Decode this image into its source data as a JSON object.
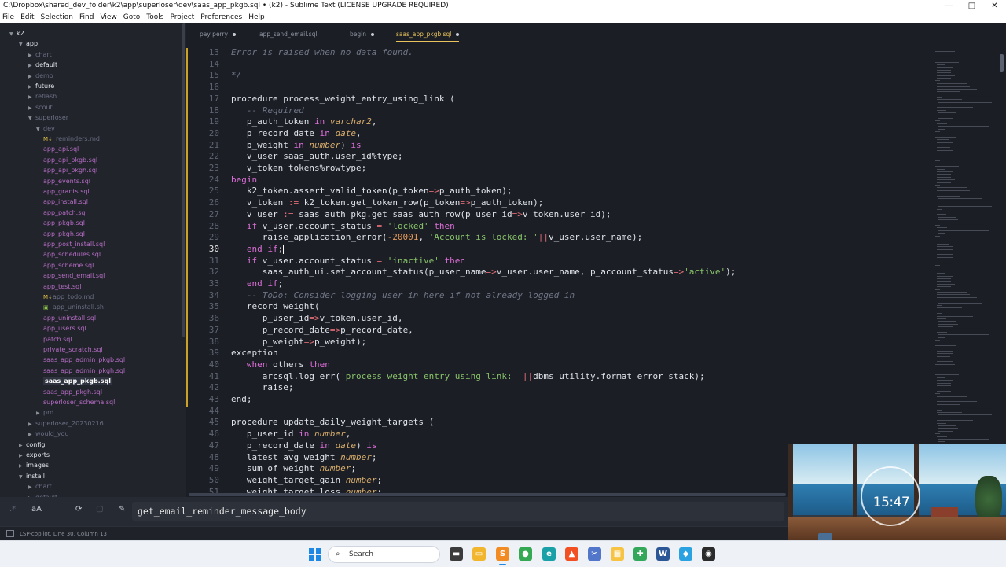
{
  "window": {
    "title": "C:\\Dropbox\\shared_dev_folder\\k2\\app\\superloser\\dev\\saas_app_pkgb.sql • (k2) - Sublime Text (LICENSE UPGRADE REQUIRED)",
    "minimize_glyph": "—",
    "maximize_glyph": "□",
    "close_glyph": "✕"
  },
  "menu": [
    "File",
    "Edit",
    "Selection",
    "Find",
    "View",
    "Goto",
    "Tools",
    "Project",
    "Preferences",
    "Help"
  ],
  "sidebar": {
    "items": [
      {
        "label": "k2",
        "kind": "folder-open",
        "depth": 0,
        "style": "bright"
      },
      {
        "label": "app",
        "kind": "folder-open",
        "depth": 1,
        "style": "bright"
      },
      {
        "label": "chart",
        "kind": "folder",
        "depth": 2,
        "style": "dim"
      },
      {
        "label": "default",
        "kind": "folder",
        "depth": 2,
        "style": "bright"
      },
      {
        "label": "demo",
        "kind": "folder",
        "depth": 2,
        "style": "dim"
      },
      {
        "label": "future",
        "kind": "folder",
        "depth": 2,
        "style": "bright"
      },
      {
        "label": "reflash",
        "kind": "folder",
        "depth": 2,
        "style": "dim"
      },
      {
        "label": "scout",
        "kind": "folder",
        "depth": 2,
        "style": "dim"
      },
      {
        "label": "superloser",
        "kind": "folder-open",
        "depth": 2,
        "style": "dim"
      },
      {
        "label": "dev",
        "kind": "folder-open",
        "depth": 3,
        "style": "dim"
      },
      {
        "label": "_reminders.md",
        "kind": "md",
        "depth": 4,
        "style": "dim"
      },
      {
        "label": "app_api.sql",
        "kind": "sql",
        "depth": 4,
        "style": "sql"
      },
      {
        "label": "app_api_pkgb.sql",
        "kind": "sql",
        "depth": 4,
        "style": "sql"
      },
      {
        "label": "app_api_pkgh.sql",
        "kind": "sql",
        "depth": 4,
        "style": "sql"
      },
      {
        "label": "app_events.sql",
        "kind": "sql",
        "depth": 4,
        "style": "sql"
      },
      {
        "label": "app_grants.sql",
        "kind": "sql",
        "depth": 4,
        "style": "sql"
      },
      {
        "label": "app_install.sql",
        "kind": "sql",
        "depth": 4,
        "style": "sql"
      },
      {
        "label": "app_patch.sql",
        "kind": "sql",
        "depth": 4,
        "style": "sql"
      },
      {
        "label": "app_pkgb.sql",
        "kind": "sql",
        "depth": 4,
        "style": "sql"
      },
      {
        "label": "app_pkgh.sql",
        "kind": "sql",
        "depth": 4,
        "style": "sql"
      },
      {
        "label": "app_post_install.sql",
        "kind": "sql",
        "depth": 4,
        "style": "sql"
      },
      {
        "label": "app_schedules.sql",
        "kind": "sql",
        "depth": 4,
        "style": "sql"
      },
      {
        "label": "app_scheme.sql",
        "kind": "sql",
        "depth": 4,
        "style": "sql"
      },
      {
        "label": "app_send_email.sql",
        "kind": "sql",
        "depth": 4,
        "style": "sql"
      },
      {
        "label": "app_test.sql",
        "kind": "sql",
        "depth": 4,
        "style": "sql"
      },
      {
        "label": "app_todo.md",
        "kind": "md",
        "depth": 4,
        "style": "dim"
      },
      {
        "label": "app_uninstall.sh",
        "kind": "sh",
        "depth": 4,
        "style": "dim"
      },
      {
        "label": "app_uninstall.sql",
        "kind": "sql",
        "depth": 4,
        "style": "sql"
      },
      {
        "label": "app_users.sql",
        "kind": "sql",
        "depth": 4,
        "style": "sql"
      },
      {
        "label": "patch.sql",
        "kind": "sql",
        "depth": 4,
        "style": "sql"
      },
      {
        "label": "private_scratch.sql",
        "kind": "sql",
        "depth": 4,
        "style": "sql"
      },
      {
        "label": "saas_app_admin_pkgb.sql",
        "kind": "sql",
        "depth": 4,
        "style": "sql"
      },
      {
        "label": "saas_app_admin_pkgh.sql",
        "kind": "sql",
        "depth": 4,
        "style": "sql"
      },
      {
        "label": "saas_app_pkgb.sql",
        "kind": "sql",
        "depth": 4,
        "style": "active"
      },
      {
        "label": "saas_app_pkgh.sql",
        "kind": "sql",
        "depth": 4,
        "style": "sql"
      },
      {
        "label": "superloser_schema.sql",
        "kind": "sql",
        "depth": 4,
        "style": "sql"
      },
      {
        "label": "prd",
        "kind": "folder",
        "depth": 3,
        "style": "dim"
      },
      {
        "label": "superloser_20230216",
        "kind": "folder",
        "depth": 2,
        "style": "dim"
      },
      {
        "label": "would_you",
        "kind": "folder",
        "depth": 2,
        "style": "dim"
      },
      {
        "label": "config",
        "kind": "folder",
        "depth": 1,
        "style": "bright"
      },
      {
        "label": "exports",
        "kind": "folder",
        "depth": 1,
        "style": "bright"
      },
      {
        "label": "images",
        "kind": "folder",
        "depth": 1,
        "style": "bright"
      },
      {
        "label": "install",
        "kind": "folder-open",
        "depth": 1,
        "style": "bright"
      },
      {
        "label": "chart",
        "kind": "folder",
        "depth": 2,
        "style": "dim"
      },
      {
        "label": "default",
        "kind": "folder",
        "depth": 2,
        "style": "dim"
      }
    ]
  },
  "tabs": [
    {
      "label": "pay perry",
      "modified": true,
      "active": false
    },
    {
      "label": "app_send_email.sql",
      "modified": false,
      "active": false
    },
    {
      "label": "begin",
      "modified": true,
      "active": false
    },
    {
      "label": "saas_app_pkgb.sql",
      "modified": true,
      "active": true
    }
  ],
  "editor": {
    "current_line": 30,
    "lines": [
      {
        "n": 13,
        "tokens": [
          {
            "t": "Error is raised when no data found.",
            "c": "c"
          }
        ]
      },
      {
        "n": 14,
        "tokens": []
      },
      {
        "n": 15,
        "tokens": [
          {
            "t": "*/",
            "c": "c"
          }
        ]
      },
      {
        "n": 16,
        "tokens": []
      },
      {
        "n": 17,
        "tokens": [
          {
            "t": "procedure process_weight_entry_using_link (",
            "c": ""
          }
        ]
      },
      {
        "n": 18,
        "tokens": [
          {
            "t": "   -- Required",
            "c": "c"
          }
        ]
      },
      {
        "n": 19,
        "tokens": [
          {
            "t": "   p_auth_token ",
            "c": ""
          },
          {
            "t": "in",
            "c": "k"
          },
          {
            "t": " ",
            "c": ""
          },
          {
            "t": "varchar2",
            "c": "t"
          },
          {
            "t": ",",
            "c": ""
          }
        ]
      },
      {
        "n": 20,
        "tokens": [
          {
            "t": "   p_record_date ",
            "c": ""
          },
          {
            "t": "in",
            "c": "k"
          },
          {
            "t": " ",
            "c": ""
          },
          {
            "t": "date",
            "c": "t"
          },
          {
            "t": ",",
            "c": ""
          }
        ]
      },
      {
        "n": 21,
        "tokens": [
          {
            "t": "   p_weight ",
            "c": ""
          },
          {
            "t": "in",
            "c": "k"
          },
          {
            "t": " ",
            "c": ""
          },
          {
            "t": "number",
            "c": "t"
          },
          {
            "t": ") ",
            "c": ""
          },
          {
            "t": "is",
            "c": "k"
          }
        ]
      },
      {
        "n": 22,
        "tokens": [
          {
            "t": "   v_user saas_auth.user_id%type;",
            "c": ""
          }
        ]
      },
      {
        "n": 23,
        "tokens": [
          {
            "t": "   v_token tokens%rowtype;",
            "c": ""
          }
        ]
      },
      {
        "n": 24,
        "tokens": [
          {
            "t": "begin",
            "c": "k"
          }
        ]
      },
      {
        "n": 25,
        "tokens": [
          {
            "t": "   k2_token.assert_valid_token(p_token",
            "c": ""
          },
          {
            "t": "=>",
            "c": "o"
          },
          {
            "t": "p_auth_token);",
            "c": ""
          }
        ]
      },
      {
        "n": 26,
        "tokens": [
          {
            "t": "   v_token ",
            "c": ""
          },
          {
            "t": ":=",
            "c": "o"
          },
          {
            "t": " k2_token.get_token_row(p_token",
            "c": ""
          },
          {
            "t": "=>",
            "c": "o"
          },
          {
            "t": "p_auth_token);",
            "c": ""
          }
        ]
      },
      {
        "n": 27,
        "tokens": [
          {
            "t": "   v_user ",
            "c": ""
          },
          {
            "t": ":=",
            "c": "o"
          },
          {
            "t": " saas_auth_pkg.get_saas_auth_row(p_user_id",
            "c": ""
          },
          {
            "t": "=>",
            "c": "o"
          },
          {
            "t": "v_token.user_id);",
            "c": ""
          }
        ]
      },
      {
        "n": 28,
        "tokens": [
          {
            "t": "   ",
            "c": ""
          },
          {
            "t": "if",
            "c": "k"
          },
          {
            "t": " v_user.account_status ",
            "c": ""
          },
          {
            "t": "=",
            "c": "o"
          },
          {
            "t": " ",
            "c": ""
          },
          {
            "t": "'locked'",
            "c": "s"
          },
          {
            "t": " ",
            "c": ""
          },
          {
            "t": "then",
            "c": "k"
          }
        ]
      },
      {
        "n": 29,
        "tokens": [
          {
            "t": "      raise_application_error(",
            "c": ""
          },
          {
            "t": "-20001",
            "c": "n"
          },
          {
            "t": ", ",
            "c": ""
          },
          {
            "t": "'Account is locked: '",
            "c": "s"
          },
          {
            "t": "||",
            "c": "o"
          },
          {
            "t": "v_user.user_name);",
            "c": ""
          }
        ]
      },
      {
        "n": 30,
        "tokens": [
          {
            "t": "   ",
            "c": ""
          },
          {
            "t": "end if",
            "c": "k"
          },
          {
            "t": ";",
            "c": ""
          }
        ],
        "cursor": true
      },
      {
        "n": 31,
        "tokens": [
          {
            "t": "   ",
            "c": ""
          },
          {
            "t": "if",
            "c": "k"
          },
          {
            "t": " v_user.account_status ",
            "c": ""
          },
          {
            "t": "=",
            "c": "o"
          },
          {
            "t": " ",
            "c": ""
          },
          {
            "t": "'inactive'",
            "c": "s"
          },
          {
            "t": " ",
            "c": ""
          },
          {
            "t": "then",
            "c": "k"
          }
        ]
      },
      {
        "n": 32,
        "tokens": [
          {
            "t": "      saas_auth_ui.set_account_status(p_user_name",
            "c": ""
          },
          {
            "t": "=>",
            "c": "o"
          },
          {
            "t": "v_user.user_name, p_account_status",
            "c": ""
          },
          {
            "t": "=>",
            "c": "o"
          },
          {
            "t": "'active'",
            "c": "s"
          },
          {
            "t": ");",
            "c": ""
          }
        ]
      },
      {
        "n": 33,
        "tokens": [
          {
            "t": "   ",
            "c": ""
          },
          {
            "t": "end if",
            "c": "k"
          },
          {
            "t": ";",
            "c": ""
          }
        ]
      },
      {
        "n": 34,
        "tokens": [
          {
            "t": "   -- ToDo: Consider logging user in here if not already logged in",
            "c": "c"
          }
        ]
      },
      {
        "n": 35,
        "tokens": [
          {
            "t": "   record_weight(",
            "c": ""
          }
        ]
      },
      {
        "n": 36,
        "tokens": [
          {
            "t": "      p_user_id",
            "c": ""
          },
          {
            "t": "=>",
            "c": "o"
          },
          {
            "t": "v_token.user_id,",
            "c": ""
          }
        ]
      },
      {
        "n": 37,
        "tokens": [
          {
            "t": "      p_record_date",
            "c": ""
          },
          {
            "t": "=>",
            "c": "o"
          },
          {
            "t": "p_record_date,",
            "c": ""
          }
        ]
      },
      {
        "n": 38,
        "tokens": [
          {
            "t": "      p_weight",
            "c": ""
          },
          {
            "t": "=>",
            "c": "o"
          },
          {
            "t": "p_weight);",
            "c": ""
          }
        ]
      },
      {
        "n": 39,
        "tokens": [
          {
            "t": "exception",
            "c": ""
          }
        ]
      },
      {
        "n": 40,
        "tokens": [
          {
            "t": "   ",
            "c": ""
          },
          {
            "t": "when",
            "c": "k"
          },
          {
            "t": " others ",
            "c": ""
          },
          {
            "t": "then",
            "c": "k"
          }
        ]
      },
      {
        "n": 41,
        "tokens": [
          {
            "t": "      arcsql.log_err(",
            "c": ""
          },
          {
            "t": "'process_weight_entry_using_link: '",
            "c": "s"
          },
          {
            "t": "||",
            "c": "o"
          },
          {
            "t": "dbms_utility.format_error_stack);",
            "c": ""
          }
        ]
      },
      {
        "n": 42,
        "tokens": [
          {
            "t": "      raise;",
            "c": ""
          }
        ]
      },
      {
        "n": 43,
        "tokens": [
          {
            "t": "end;",
            "c": ""
          }
        ]
      },
      {
        "n": 44,
        "tokens": []
      },
      {
        "n": 45,
        "tokens": [
          {
            "t": "procedure update_daily_weight_targets (",
            "c": ""
          }
        ]
      },
      {
        "n": 46,
        "tokens": [
          {
            "t": "   p_user_id ",
            "c": ""
          },
          {
            "t": "in",
            "c": "k"
          },
          {
            "t": " ",
            "c": ""
          },
          {
            "t": "number",
            "c": "t"
          },
          {
            "t": ",",
            "c": ""
          }
        ]
      },
      {
        "n": 47,
        "tokens": [
          {
            "t": "   p_record_date ",
            "c": ""
          },
          {
            "t": "in",
            "c": "k"
          },
          {
            "t": " ",
            "c": ""
          },
          {
            "t": "date",
            "c": "t"
          },
          {
            "t": ") ",
            "c": ""
          },
          {
            "t": "is",
            "c": "k"
          }
        ]
      },
      {
        "n": 48,
        "tokens": [
          {
            "t": "   latest_avg_weight ",
            "c": ""
          },
          {
            "t": "number",
            "c": "t"
          },
          {
            "t": ";",
            "c": ""
          }
        ]
      },
      {
        "n": 49,
        "tokens": [
          {
            "t": "   sum_of_weight ",
            "c": ""
          },
          {
            "t": "number",
            "c": "t"
          },
          {
            "t": ";",
            "c": ""
          }
        ]
      },
      {
        "n": 50,
        "tokens": [
          {
            "t": "   weight_target_gain ",
            "c": ""
          },
          {
            "t": "number",
            "c": "t"
          },
          {
            "t": ";",
            "c": ""
          }
        ]
      },
      {
        "n": 51,
        "tokens": [
          {
            "t": "   weight_target_loss ",
            "c": ""
          },
          {
            "t": "number",
            "c": "t"
          },
          {
            "t": ";",
            "c": ""
          }
        ]
      }
    ]
  },
  "find_panel": {
    "regex_glyph": ".*",
    "case_label": "aA",
    "wrap_glyph": "⟳",
    "selection_glyph": "▢",
    "highlight_glyph": "✎",
    "input_value": "get_email_reminder_message_body"
  },
  "statusbar": {
    "text": "LSP-copilot, Line 30, Column 13"
  },
  "overlay": {
    "clock_time": "15:47"
  },
  "taskbar": {
    "search_placeholder": "Search",
    "search_glyph": "⌕",
    "apps": [
      {
        "name": "file-explorer",
        "glyph": "▬",
        "color": "#3b3b3b"
      },
      {
        "name": "folder",
        "glyph": "▭",
        "color": "#f2b52e"
      },
      {
        "name": "sublime-text",
        "glyph": "S",
        "color": "#f28b22"
      },
      {
        "name": "chrome",
        "glyph": "●",
        "color": "#34a853"
      },
      {
        "name": "edge",
        "glyph": "e",
        "color": "#1aa1a8"
      },
      {
        "name": "brave",
        "glyph": "▲",
        "color": "#f25022"
      },
      {
        "name": "snipping-tool",
        "glyph": "✂",
        "color": "#5276c9"
      },
      {
        "name": "notes",
        "glyph": "▦",
        "color": "#f6c343"
      },
      {
        "name": "vpn",
        "glyph": "✚",
        "color": "#33a85a"
      },
      {
        "name": "word",
        "glyph": "W",
        "color": "#2b5797"
      },
      {
        "name": "photos",
        "glyph": "◆",
        "color": "#2aa1e1"
      },
      {
        "name": "obs",
        "glyph": "◉",
        "color": "#2b2b2b"
      }
    ]
  }
}
